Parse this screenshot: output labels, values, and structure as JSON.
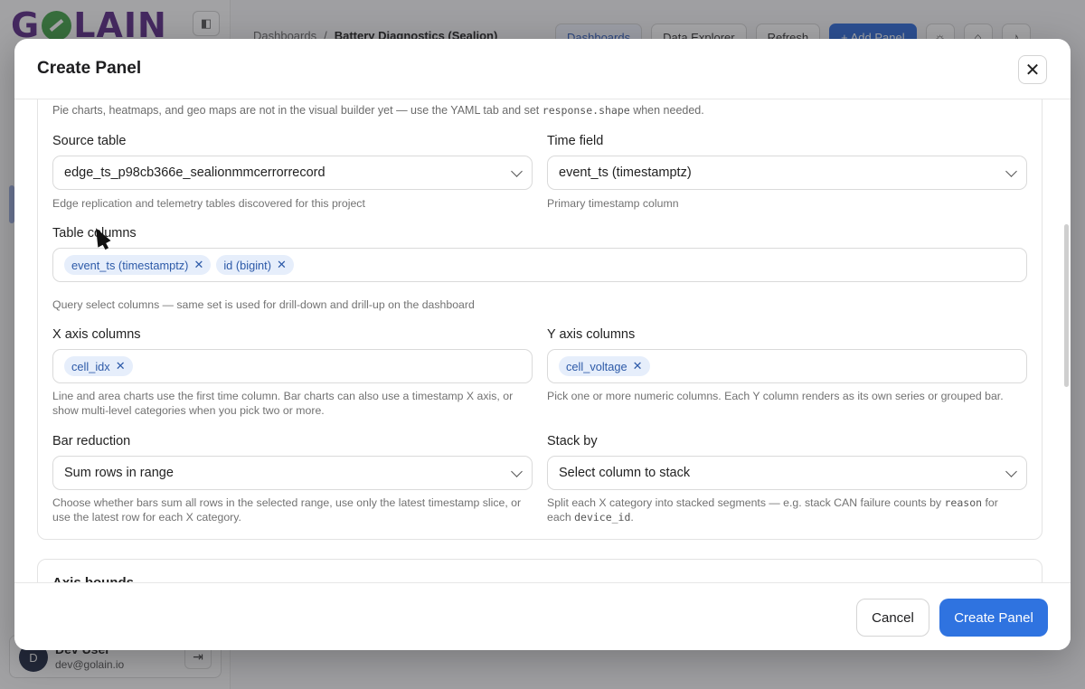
{
  "app": {
    "logo_text": "GOLAIN",
    "breadcrumb": [
      "Dashboards",
      "/",
      "Battery Diagnostics (Sealion)"
    ],
    "top_actions": [
      "Dashboards",
      "Data Explorer",
      "Refresh",
      "+ Add Panel"
    ],
    "user": {
      "initial": "D",
      "name": "Dev User",
      "email": "dev@golain.io"
    }
  },
  "modal": {
    "title": "Create Panel",
    "note_text": "Pie charts, heatmaps, and geo maps are not in the visual builder yet — use the YAML tab and set",
    "note_code": "response.shape",
    "note_tail": "when needed.",
    "source_table": {
      "label": "Source table",
      "value": "edge_ts_p98cb366e_sealionmmcerrorrecord",
      "help": "Edge replication and telemetry tables discovered for this project"
    },
    "time_field": {
      "label": "Time field",
      "value": "event_ts (timestamptz)",
      "help": "Primary timestamp column"
    },
    "table_columns": {
      "label": "Table columns",
      "chips": [
        "event_ts (timestamptz)",
        "id (bigint)"
      ],
      "help": "Query select columns — same set is used for drill-down and drill-up on the dashboard"
    },
    "x_axis": {
      "label": "X axis columns",
      "chips": [
        "cell_idx"
      ],
      "help_line1": "Line and area charts use the first time column. Bar charts can also use a timestamp X axis, or",
      "help_line2": "show multi-level categories when you pick two or more."
    },
    "y_axis": {
      "label": "Y axis columns",
      "chips": [
        "cell_voltage"
      ],
      "help": "Pick one or more numeric columns. Each Y column renders as its own series or grouped bar."
    },
    "bar_reduction": {
      "label": "Bar reduction",
      "value": "Sum rows in range",
      "help_line1": "Choose whether bars sum all rows in the selected range, use only the latest timestamp slice, or",
      "help_line2": "use the latest row for each X category."
    },
    "stack_by": {
      "label": "Stack by",
      "placeholder": "Select column to stack",
      "help_a": "Split each X category into stacked segments — e.g. stack CAN failure counts by",
      "help_code1": "reason",
      "help_b": "for",
      "help_c": "each",
      "help_code2": "device_id",
      "help_d": "."
    },
    "next_section_title": "Axis bounds",
    "footer": {
      "cancel": "Cancel",
      "create": "Create Panel"
    }
  },
  "icons": {
    "close": "close-icon",
    "chevron": "chevron-down-icon",
    "chip_remove": "x-icon"
  },
  "colors": {
    "primary": "#2f73e0",
    "chip_bg": "#e6eefb",
    "chip_text": "#2d5aa8"
  }
}
